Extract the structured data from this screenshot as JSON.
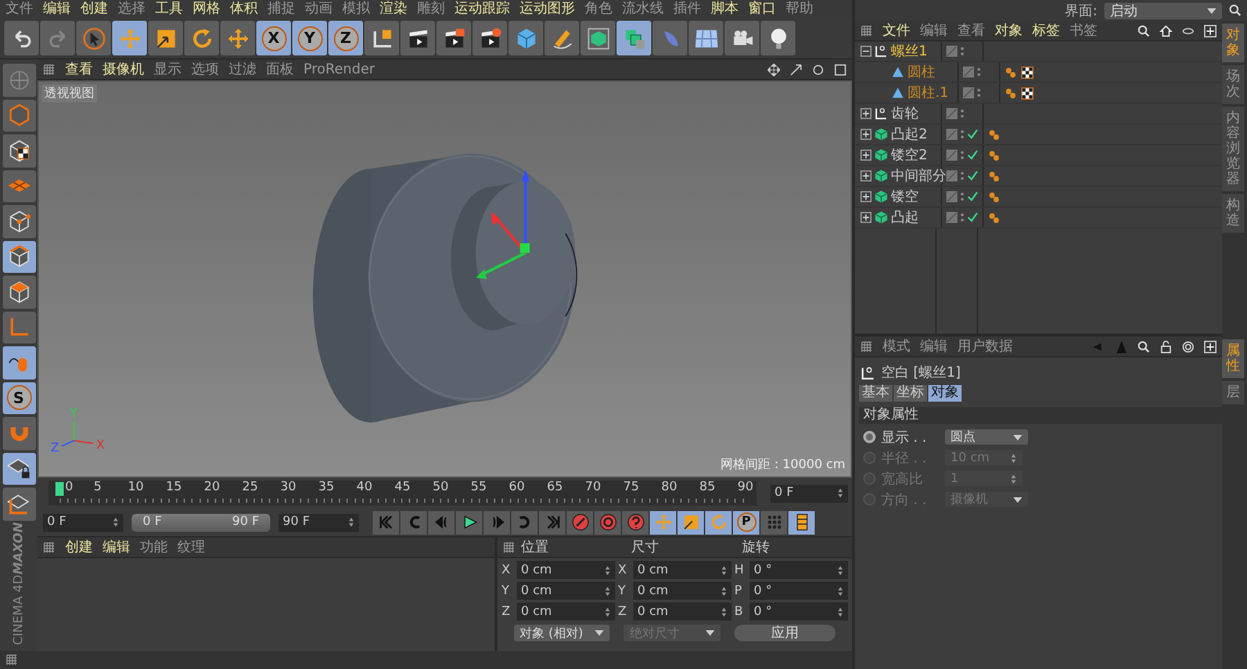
{
  "menu": [
    {
      "label": "文件",
      "highlighted": false
    },
    {
      "label": "编辑",
      "highlighted": true
    },
    {
      "label": "创建",
      "highlighted": true
    },
    {
      "label": "选择",
      "highlighted": false
    },
    {
      "label": "工具",
      "highlighted": true
    },
    {
      "label": "网格",
      "highlighted": true
    },
    {
      "label": "体积",
      "highlighted": true
    },
    {
      "label": "捕捉",
      "highlighted": false
    },
    {
      "label": "动画",
      "highlighted": false
    },
    {
      "label": "模拟",
      "highlighted": false
    },
    {
      "label": "渲染",
      "highlighted": true
    },
    {
      "label": "雕刻",
      "highlighted": false
    },
    {
      "label": "运动跟踪",
      "highlighted": true
    },
    {
      "label": "运动图形",
      "highlighted": true
    },
    {
      "label": "角色",
      "highlighted": false
    },
    {
      "label": "流水线",
      "highlighted": false
    },
    {
      "label": "插件",
      "highlighted": false
    },
    {
      "label": "脚本",
      "highlighted": true
    },
    {
      "label": "窗口",
      "highlighted": true
    },
    {
      "label": "帮助",
      "highlighted": false
    }
  ],
  "toolbar": [
    {
      "kind": "undo",
      "active": false
    },
    {
      "kind": "redo",
      "active": false
    },
    {
      "kind": "select",
      "active": false
    },
    {
      "kind": "move",
      "active": true
    },
    {
      "kind": "scale",
      "active": false
    },
    {
      "kind": "rotate",
      "active": false
    },
    {
      "kind": "recent",
      "active": false
    },
    {
      "kind": "axis",
      "label": "X",
      "active": true
    },
    {
      "kind": "axis",
      "label": "Y",
      "active": true
    },
    {
      "kind": "axis",
      "label": "Z",
      "active": true
    },
    {
      "kind": "coord",
      "active": false
    },
    {
      "kind": "render-view",
      "active": false
    },
    {
      "kind": "render-picture",
      "active": false
    },
    {
      "kind": "render-settings",
      "active": false
    },
    {
      "kind": "cube",
      "active": false
    },
    {
      "kind": "pen",
      "active": false
    },
    {
      "kind": "subdivision",
      "active": false
    },
    {
      "kind": "cloner",
      "active": true
    },
    {
      "kind": "deformer",
      "active": false
    },
    {
      "kind": "floor",
      "active": false
    },
    {
      "kind": "camera",
      "active": false
    },
    {
      "kind": "light",
      "active": false
    }
  ],
  "interface": {
    "label": "界面:",
    "value": "启动"
  },
  "left_toolbar": [
    {
      "kind": "model",
      "active": false
    },
    {
      "kind": "object",
      "active": false
    },
    {
      "kind": "texture",
      "active": false
    },
    {
      "kind": "workplane",
      "active": false
    },
    {
      "kind": "points",
      "active": false
    },
    {
      "kind": "edges",
      "active": true
    },
    {
      "kind": "polygons",
      "active": false
    },
    {
      "kind": "axis",
      "active": false
    },
    {
      "kind": "tweak",
      "active": true
    },
    {
      "kind": "snap",
      "label": "S",
      "active": true
    },
    {
      "kind": "magnet",
      "active": false
    },
    {
      "kind": "lock-workplane",
      "active": true
    },
    {
      "kind": "workplane-axis",
      "active": false
    }
  ],
  "logo": {
    "brand": "MAXON",
    "product": "CINEMA 4D"
  },
  "viewport": {
    "menu": [
      {
        "label": "查看",
        "highlighted": true
      },
      {
        "label": "摄像机",
        "highlighted": true
      },
      {
        "label": "显示",
        "highlighted": false
      },
      {
        "label": "选项",
        "highlighted": false
      },
      {
        "label": "过滤",
        "highlighted": false
      },
      {
        "label": "面板",
        "highlighted": false
      },
      {
        "label": "ProRender",
        "highlighted": false
      }
    ],
    "view_label": "透视视图",
    "grid_spacing": "网格间距 : 10000 cm",
    "axis_labels": [
      "Y",
      "Z",
      "X"
    ]
  },
  "timeline": {
    "ticks": [
      "0",
      "5",
      "10",
      "15",
      "20",
      "25",
      "30",
      "35",
      "40",
      "45",
      "50",
      "55",
      "60",
      "65",
      "70",
      "75",
      "80",
      "85",
      "90"
    ],
    "level": 0,
    "current_frame": "0 F",
    "start": "0 F",
    "range": {
      "start": "0 F",
      "end": "90 F",
      "level": 1
    },
    "end": "90 F"
  },
  "transport": [
    {
      "kind": "first",
      "active": false
    },
    {
      "kind": "prev-key",
      "active": false
    },
    {
      "kind": "prev-frame",
      "active": false
    },
    {
      "kind": "play",
      "active": false
    },
    {
      "kind": "next-frame",
      "active": false
    },
    {
      "kind": "next-key",
      "active": false
    },
    {
      "kind": "last",
      "active": false
    },
    {
      "kind": "record",
      "active": false
    },
    {
      "kind": "autokey",
      "active": false
    },
    {
      "kind": "key-help",
      "active": false
    },
    {
      "kind": "key-move",
      "active": true
    },
    {
      "kind": "key-scale",
      "active": true
    },
    {
      "kind": "key-rotate",
      "active": true
    },
    {
      "kind": "key-param",
      "label": "P",
      "active": true
    },
    {
      "kind": "key-points",
      "active": false
    },
    {
      "kind": "timeline",
      "active": true
    }
  ],
  "material_manager": {
    "menu": [
      {
        "label": "创建",
        "highlighted": true
      },
      {
        "label": "编辑",
        "highlighted": true
      },
      {
        "label": "功能",
        "highlighted": false
      },
      {
        "label": "纹理",
        "highlighted": false
      }
    ]
  },
  "coordinates": {
    "headers": [
      "位置",
      "尺寸",
      "旋转"
    ],
    "rows": [
      {
        "axes": [
          "X",
          "X",
          "H"
        ],
        "values": [
          "0 cm",
          "0 cm",
          "0 °"
        ]
      },
      {
        "axes": [
          "Y",
          "Y",
          "P"
        ],
        "values": [
          "0 cm",
          "0 cm",
          "0 °"
        ]
      },
      {
        "axes": [
          "Z",
          "Z",
          "B"
        ],
        "values": [
          "0 cm",
          "0 cm",
          "0 °"
        ]
      }
    ],
    "mode": {
      "value": "对象 (相对)",
      "disabled": false
    },
    "size_mode": {
      "value": "绝对尺寸",
      "disabled": true
    },
    "apply": "应用"
  },
  "object_manager": {
    "menu": [
      {
        "label": "文件",
        "highlighted": true
      },
      {
        "label": "编辑",
        "highlighted": false
      },
      {
        "label": "查看",
        "highlighted": false
      },
      {
        "label": "对象",
        "highlighted": true
      },
      {
        "label": "标签",
        "highlighted": true
      },
      {
        "label": "书签",
        "highlighted": false
      }
    ],
    "objects": [
      {
        "name": "螺丝1",
        "kind": "null",
        "selected": true,
        "expanded": true,
        "children": [
          {
            "name": "圆柱",
            "kind": "primitive",
            "selected": true,
            "tags": [
              {
                "kind": "phong"
              },
              {
                "kind": "material"
              }
            ]
          },
          {
            "name": "圆柱.1",
            "kind": "primitive",
            "selected": true,
            "tags": [
              {
                "kind": "phong"
              },
              {
                "kind": "material"
              }
            ]
          }
        ]
      },
      {
        "name": "齿轮",
        "kind": "null",
        "selected": false,
        "expanded": false
      },
      {
        "name": "凸起2",
        "kind": "generator",
        "selected": false,
        "expanded": false,
        "enabled": true,
        "tags": [
          {
            "kind": "phong"
          }
        ]
      },
      {
        "name": "镂空2",
        "kind": "generator",
        "selected": false,
        "expanded": false,
        "enabled": true,
        "tags": [
          {
            "kind": "phong"
          }
        ]
      },
      {
        "name": "中间部分",
        "kind": "generator",
        "selected": false,
        "expanded": false,
        "enabled": true,
        "tags": [
          {
            "kind": "phong"
          }
        ]
      },
      {
        "name": "镂空",
        "kind": "generator",
        "selected": false,
        "expanded": false,
        "enabled": true,
        "tags": [
          {
            "kind": "phong"
          }
        ]
      },
      {
        "name": "凸起",
        "kind": "generator",
        "selected": false,
        "expanded": false,
        "enabled": true,
        "tags": [
          {
            "kind": "phong"
          }
        ]
      }
    ]
  },
  "side_tabs_top": [
    {
      "label": "对象",
      "selected": true
    },
    {
      "label": "场次",
      "selected": false
    },
    {
      "label": "内容浏览器",
      "selected": false
    },
    {
      "label": "构造",
      "selected": false
    }
  ],
  "attribute_manager": {
    "menu": [
      {
        "label": "模式",
        "highlighted": false
      },
      {
        "label": "编辑",
        "highlighted": false
      },
      {
        "label": "用户数据",
        "highlighted": false
      }
    ],
    "object_label": "空白 [螺丝1]",
    "tabs": [
      {
        "label": "基本",
        "selected": false
      },
      {
        "label": "坐标",
        "selected": false
      },
      {
        "label": "对象",
        "selected": true
      }
    ],
    "section": "对象属性",
    "fields": [
      {
        "label": "显示 . .",
        "value": "圆点",
        "kind": "dropdown",
        "disabled": false
      },
      {
        "label": "半径 . .",
        "value": "10 cm",
        "kind": "number",
        "disabled": true
      },
      {
        "label": "宽高比",
        "value": "1",
        "kind": "number",
        "disabled": true
      },
      {
        "label": "方向 . .",
        "value": "摄像机",
        "kind": "dropdown",
        "disabled": true
      }
    ]
  },
  "side_tabs_bottom": [
    {
      "label": "属性",
      "selected": true
    },
    {
      "label": "层",
      "selected": false
    }
  ]
}
